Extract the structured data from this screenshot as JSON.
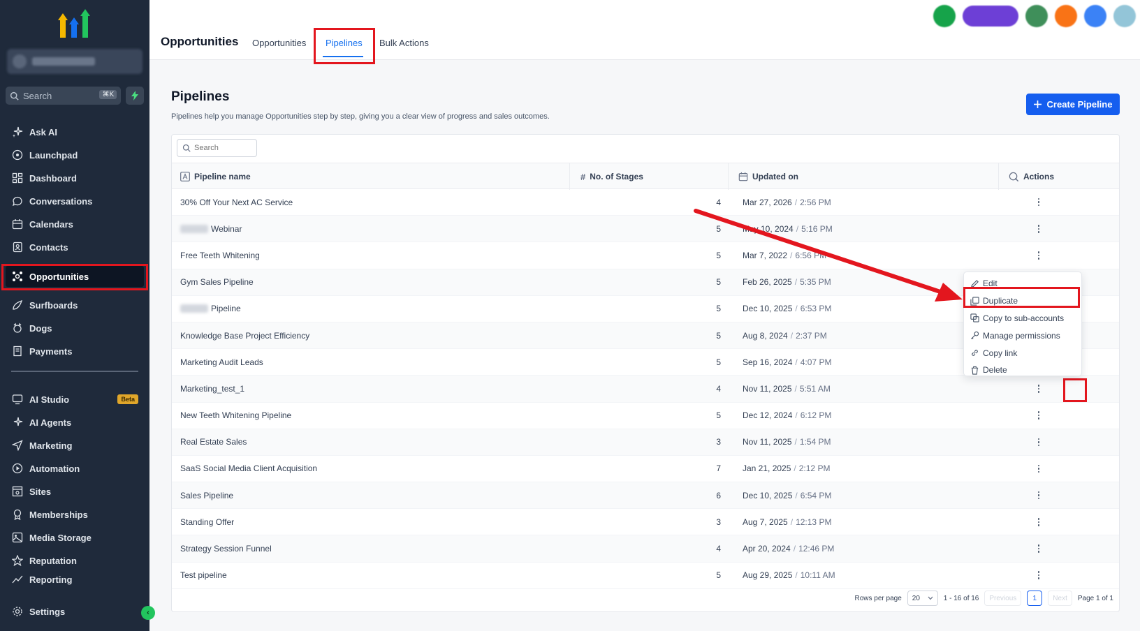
{
  "sidebar": {
    "search_placeholder": "Search",
    "search_shortcut": "⌘K",
    "items": [
      {
        "label": "Ask AI",
        "icon": "sparkle-icon"
      },
      {
        "label": "Launchpad",
        "icon": "rocket-icon"
      },
      {
        "label": "Dashboard",
        "icon": "grid-icon"
      },
      {
        "label": "Conversations",
        "icon": "chat-icon"
      },
      {
        "label": "Calendars",
        "icon": "calendar-icon"
      },
      {
        "label": "Contacts",
        "icon": "contacts-icon"
      },
      {
        "label": "Opportunities",
        "icon": "opportunities-icon"
      },
      {
        "label": "Surfboards",
        "icon": "surfboard-icon"
      },
      {
        "label": "Dogs",
        "icon": "dog-icon"
      },
      {
        "label": "Payments",
        "icon": "receipt-icon"
      }
    ],
    "items2": [
      {
        "label": "AI Studio",
        "icon": "ai-studio-icon",
        "badge": "Beta"
      },
      {
        "label": "AI Agents",
        "icon": "sparkle-icon"
      },
      {
        "label": "Marketing",
        "icon": "send-icon"
      },
      {
        "label": "Automation",
        "icon": "automation-icon"
      },
      {
        "label": "Sites",
        "icon": "sites-icon"
      },
      {
        "label": "Memberships",
        "icon": "award-icon"
      },
      {
        "label": "Media Storage",
        "icon": "image-icon"
      },
      {
        "label": "Reputation",
        "icon": "star-icon"
      },
      {
        "label": "Reporting",
        "icon": "chart-icon"
      }
    ],
    "settings": "Settings"
  },
  "header": {
    "title": "Opportunities",
    "tabs": [
      "Opportunities",
      "Pipelines",
      "Bulk Actions"
    ],
    "active_tab": "Pipelines"
  },
  "main": {
    "title": "Pipelines",
    "subtitle": "Pipelines help you manage Opportunities step by step, giving you a clear view of progress and sales outcomes.",
    "create_button": "Create Pipeline",
    "search_placeholder": "Search",
    "columns": [
      "Pipeline name",
      "No. of Stages",
      "Updated on",
      "Actions"
    ],
    "rows": [
      {
        "name": "30% Off Your Next AC Service",
        "blurred_prefix": false,
        "stages": "4",
        "date": "Mar 27, 2026",
        "time": "2:56 PM"
      },
      {
        "name": "Webinar",
        "blurred_prefix": true,
        "stages": "5",
        "date": "May 10, 2024",
        "time": "5:16 PM"
      },
      {
        "name": "Free Teeth Whitening",
        "blurred_prefix": false,
        "stages": "5",
        "date": "Mar 7, 2022",
        "time": "6:56 PM"
      },
      {
        "name": "Gym Sales Pipeline",
        "blurred_prefix": false,
        "stages": "5",
        "date": "Feb 26, 2025",
        "time": "5:35 PM"
      },
      {
        "name": "Pipeline",
        "blurred_prefix": true,
        "stages": "5",
        "date": "Dec 10, 2025",
        "time": "6:53 PM"
      },
      {
        "name": "Knowledge Base Project Efficiency",
        "blurred_prefix": false,
        "stages": "5",
        "date": "Aug 8, 2024",
        "time": "2:37 PM"
      },
      {
        "name": "Marketing Audit Leads",
        "blurred_prefix": false,
        "stages": "5",
        "date": "Sep 16, 2024",
        "time": "4:07 PM"
      },
      {
        "name": "Marketing_test_1",
        "blurred_prefix": false,
        "stages": "4",
        "date": "Nov 11, 2025",
        "time": "5:51 AM"
      },
      {
        "name": "New Teeth Whitening Pipeline",
        "blurred_prefix": false,
        "stages": "5",
        "date": "Dec 12, 2024",
        "time": "6:12 PM"
      },
      {
        "name": "Real Estate Sales",
        "blurred_prefix": false,
        "stages": "3",
        "date": "Nov 11, 2025",
        "time": "1:54 PM"
      },
      {
        "name": "SaaS Social Media Client Acquisition",
        "blurred_prefix": false,
        "stages": "7",
        "date": "Jan 21, 2025",
        "time": "2:12 PM"
      },
      {
        "name": "Sales Pipeline",
        "blurred_prefix": false,
        "stages": "6",
        "date": "Dec 10, 2025",
        "time": "6:54 PM"
      },
      {
        "name": "Standing Offer",
        "blurred_prefix": false,
        "stages": "3",
        "date": "Aug 7, 2025",
        "time": "12:13 PM"
      },
      {
        "name": "Strategy Session Funnel",
        "blurred_prefix": false,
        "stages": "4",
        "date": "Apr 20, 2024",
        "time": "12:46 PM"
      },
      {
        "name": "Test pipeline",
        "blurred_prefix": false,
        "stages": "5",
        "date": "Aug 29, 2025",
        "time": "10:11 AM"
      }
    ],
    "pagination": {
      "rows_per_page_label": "Rows per page",
      "rows_per_page": "20",
      "range": "1 - 16 of 16",
      "previous": "Previous",
      "current": "1",
      "next": "Next",
      "page_info": "Page 1 of 1"
    }
  },
  "menu": {
    "items": [
      {
        "label": "Edit",
        "icon": "pencil-icon"
      },
      {
        "label": "Duplicate",
        "icon": "duplicate-icon"
      },
      {
        "label": "Copy to sub-accounts",
        "icon": "copy-icon"
      },
      {
        "label": "Manage permissions",
        "icon": "key-icon"
      },
      {
        "label": "Copy link",
        "icon": "link-icon"
      },
      {
        "label": "Delete",
        "icon": "trash-icon"
      }
    ]
  },
  "colors": {
    "sidebar_bg": "#1f2a3b",
    "accent": "#155eef",
    "highlight": "#e3161e"
  }
}
